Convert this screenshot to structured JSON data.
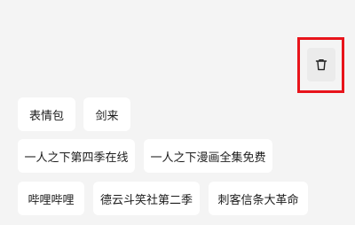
{
  "history": {
    "delete_icon": "trash-icon",
    "highlight_color": "#e8141b",
    "items": [
      {
        "label": "表情包"
      },
      {
        "label": "剑来"
      },
      {
        "label": "一人之下第四季在线"
      },
      {
        "label": "一人之下漫画全集免费"
      },
      {
        "label": "哔哩哔哩"
      },
      {
        "label": "德云斗笑社第二季"
      },
      {
        "label": "刺客信条大革命"
      }
    ]
  }
}
